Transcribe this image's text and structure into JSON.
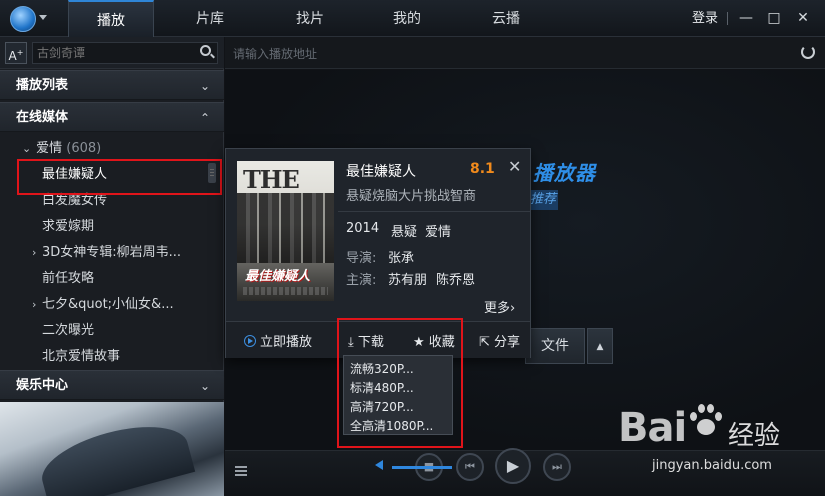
{
  "titlebar": {
    "tabs": [
      {
        "label": "播放",
        "active": true
      },
      {
        "label": "片库",
        "active": false
      },
      {
        "label": "找片",
        "active": false
      },
      {
        "label": "我的",
        "active": false
      },
      {
        "label": "云播",
        "active": false
      }
    ],
    "login_label": "登录",
    "minimize": "—",
    "maximize": "□",
    "close": "✕"
  },
  "sidebar": {
    "font_button": "A",
    "font_button_sup": "+",
    "search_placeholder": "古剑奇谭",
    "sections": {
      "playlist": "播放列表",
      "online_media": "在线媒体",
      "entertainment": "娱乐中心"
    },
    "category": {
      "label": "爱情",
      "count": "(608)"
    },
    "items": [
      {
        "label": "最佳嫌疑人",
        "has_children": false,
        "selected": true
      },
      {
        "label": "白发魔女传",
        "has_children": false
      },
      {
        "label": "求爱嫁期",
        "has_children": false
      },
      {
        "label": "3D女神专辑:柳岩周韦...",
        "has_children": true
      },
      {
        "label": "前任攻略",
        "has_children": false
      },
      {
        "label": "七夕&quot;小仙女&...",
        "has_children": true
      },
      {
        "label": "二次曝光",
        "has_children": false
      },
      {
        "label": "北京爱情故事",
        "has_children": false
      }
    ]
  },
  "urlbar": {
    "placeholder": "请输入播放地址"
  },
  "main": {
    "brand_text": "播放器",
    "brand_sub": "推荐",
    "open_file_label": "文件"
  },
  "card": {
    "title": "最佳嫌疑人",
    "score": "8.1",
    "tagline": "悬疑烧脑大片挑战智商",
    "year": "2014",
    "genres": [
      "悬疑",
      "爱情"
    ],
    "director_label": "导演:",
    "director": "张承",
    "cast_label": "主演:",
    "cast": [
      "苏有朋",
      "陈乔恩"
    ],
    "more_label": "更多",
    "poster_title": "THE",
    "poster_subtitle": "最佳嫌疑人",
    "actions": {
      "play": "立即播放",
      "download": "下载",
      "favorite": "收藏",
      "share": "分享"
    }
  },
  "download_menu": {
    "options": [
      "流畅320P...",
      "标清480P...",
      "高清720P...",
      "全高清1080P..."
    ]
  },
  "watermark": {
    "brand": "Bai",
    "brand_suffix": "经验",
    "url": "jingyan.baidu.com"
  },
  "colors": {
    "accent": "#2f86d8",
    "score": "#f08a1c",
    "highlight_box": "#e0141a"
  }
}
